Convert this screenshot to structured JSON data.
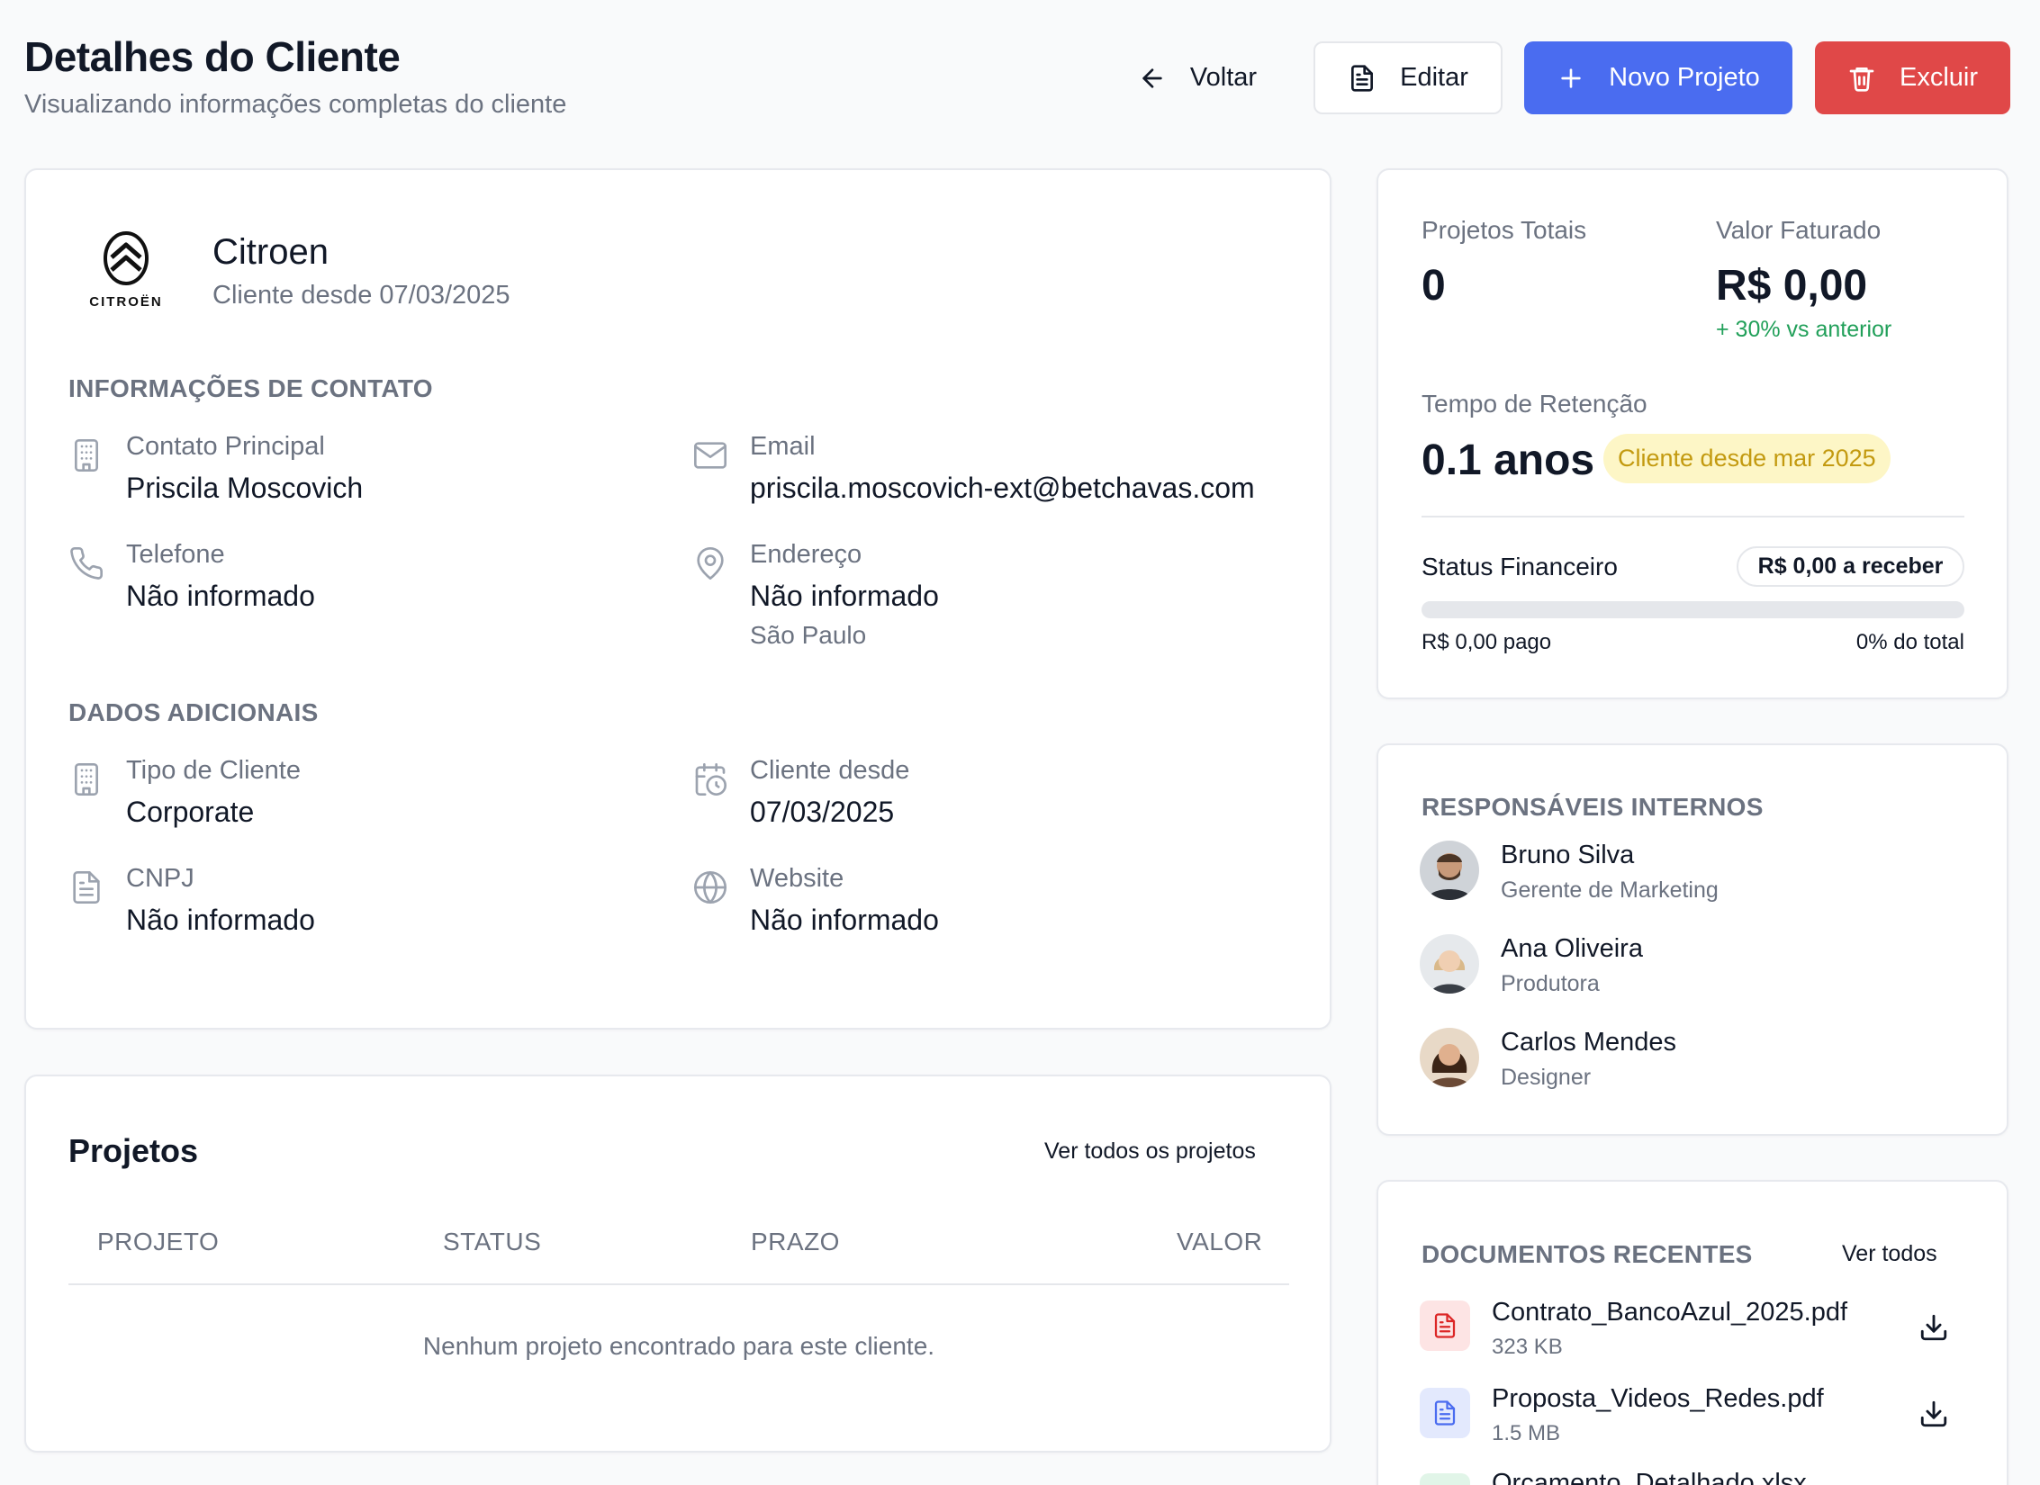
{
  "header": {
    "title": "Detalhes do Cliente",
    "subtitle": "Visualizando informações completas do cliente",
    "back_label": "Voltar",
    "edit_label": "Editar",
    "new_project_label": "Novo Projeto",
    "delete_label": "Excluir"
  },
  "client": {
    "logo_text": "CITROËN",
    "name": "Citroen",
    "since_line": "Cliente desde 07/03/2025"
  },
  "contact": {
    "section_title": "INFORMAÇÕES DE CONTATO",
    "main_contact_label": "Contato Principal",
    "main_contact_value": "Priscila Moscovich",
    "email_label": "Email",
    "email_value": "priscila.moscovich-ext@betchavas.com",
    "phone_label": "Telefone",
    "phone_value": "Não informado",
    "address_label": "Endereço",
    "address_value": "Não informado",
    "address_city": "São Paulo"
  },
  "additional": {
    "section_title": "DADOS ADICIONAIS",
    "type_label": "Tipo de Cliente",
    "type_value": "Corporate",
    "since_label": "Cliente desde",
    "since_value": "07/03/2025",
    "cnpj_label": "CNPJ",
    "cnpj_value": "Não informado",
    "website_label": "Website",
    "website_value": "Não informado"
  },
  "projects": {
    "title": "Projetos",
    "view_all": "Ver todos os projetos",
    "columns": [
      "PROJETO",
      "STATUS",
      "PRAZO",
      "VALOR"
    ],
    "empty_message": "Nenhum projeto encontrado para este cliente."
  },
  "stats": {
    "total_projects_label": "Projetos Totais",
    "total_projects_value": "0",
    "billed_label": "Valor Faturado",
    "billed_value": "R$ 0,00",
    "billed_trend": "+ 30% vs anterior",
    "retention_label": "Tempo de Retenção",
    "retention_value": "0.1 anos",
    "retention_badge": "Cliente desde mar 2025",
    "financial_label": "Status Financeiro",
    "receivable_badge": "R$ 0,00 a receber",
    "paid_text": "R$ 0,00 pago",
    "percent_text": "0% do total",
    "progress_fraction": 0
  },
  "team": {
    "section_title": "RESPONSÁVEIS INTERNOS",
    "members": [
      {
        "name": "Bruno Silva",
        "role": "Gerente de Marketing"
      },
      {
        "name": "Ana Oliveira",
        "role": "Produtora"
      },
      {
        "name": "Carlos Mendes",
        "role": "Designer"
      }
    ]
  },
  "documents": {
    "section_title": "DOCUMENTOS RECENTES",
    "view_all": "Ver todos",
    "items": [
      {
        "name": "Contrato_BancoAzul_2025.pdf",
        "size": "323 KB",
        "icon": "file-pdf-icon"
      },
      {
        "name": "Proposta_Videos_Redes.pdf",
        "size": "1.5 MB",
        "icon": "file-doc-icon"
      },
      {
        "name": "Orcamento_Detalhado.xlsx",
        "size": "",
        "icon": "file-sheet-icon"
      }
    ]
  },
  "colors": {
    "primary": "#4a6cf0",
    "danger": "#e04848",
    "success": "#22a05a",
    "badge_yellow_bg": "#fdf6c6",
    "badge_yellow_text": "#c39a10"
  }
}
